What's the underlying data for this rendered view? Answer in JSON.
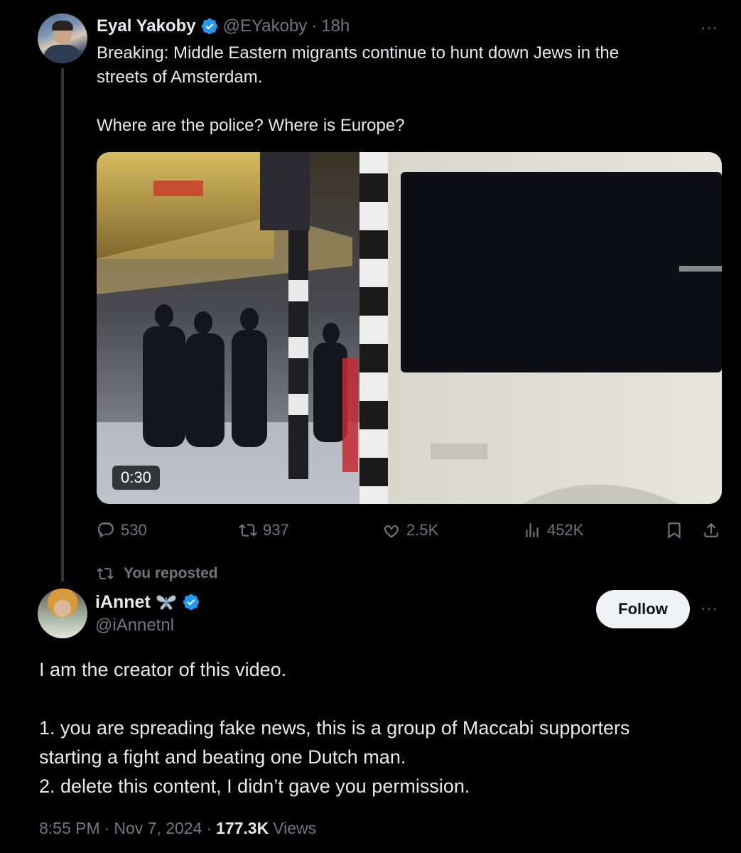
{
  "tweet1": {
    "author_name": "Eyal Yakoby",
    "handle": "@EYakoby",
    "separator": "·",
    "time": "18h",
    "more": "···",
    "text": "Breaking: Middle Eastern migrants continue to hunt down Jews in the\nstreets of Amsterdam.\n\nWhere are the police? Where is Europe?",
    "video_duration": "0:30",
    "stats": {
      "replies": "530",
      "reposts": "937",
      "likes": "2.5K",
      "views": "452K"
    },
    "icons": [
      "reply-icon",
      "repost-icon",
      "like-icon",
      "views-icon",
      "bookmark-icon",
      "share-icon"
    ]
  },
  "repost_label": "You reposted",
  "tweet2": {
    "author_name": "iAnnet",
    "emoji": "butterfly",
    "handle": "@iAnnetnl",
    "follow_label": "Follow",
    "more": "···",
    "text": "I am the creator of this video.\n\n1. you are spreading fake news, this is a group of Maccabi supporters\nstarting a fight and beating one Dutch man.\n2. delete this content, I didn’t gave you permission.",
    "time": "8:55 PM",
    "separator": "·",
    "date": "Nov 7, 2024",
    "separator2": "·",
    "views_count": "177.3K",
    "views_label": "Views"
  },
  "colors": {
    "background": "#000000",
    "text": "#e7e9ea",
    "muted": "#71767b",
    "verified": "#1d9bf0",
    "follow_bg": "#eff3f4"
  }
}
